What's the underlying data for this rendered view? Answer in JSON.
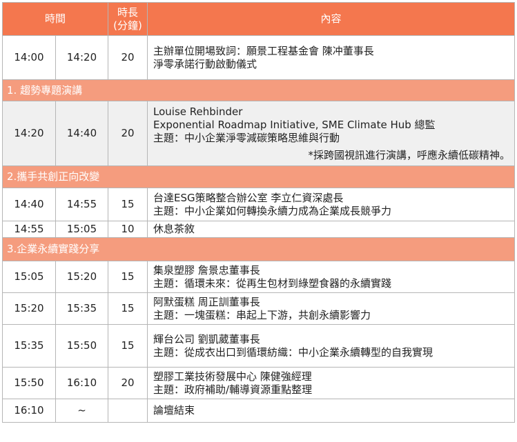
{
  "header": {
    "time": "時間",
    "duration_line1": "時長",
    "duration_line2": "(分鐘)",
    "content": "內容"
  },
  "rows": [
    {
      "start": "14:00",
      "end": "14:20",
      "duration": "20",
      "lines": [
        "主辦單位開場致詞：願景工程基金會 陳冲董事長",
        "淨零承諾行動啟動儀式"
      ]
    },
    {
      "section": "1. 趨勢專題演講"
    },
    {
      "start": "14:20",
      "end": "14:40",
      "duration": "20",
      "lines": [
        "Louise Rehbinder",
        "Exponential Roadmap Initiative, SME Climate Hub 總監",
        "主題：中小企業淨零減碳策略思維與行動"
      ],
      "note": "*採跨國視訊進行演講，呼應永續低碳精神。"
    },
    {
      "section": "2.攜手共創正向改變"
    },
    {
      "start": "14:40",
      "end": "14:55",
      "duration": "15",
      "lines": [
        "台達ESG策略整合辦公室  李立仁資深處長",
        "主題：中小企業如何轉換永續力成為企業成長競爭力"
      ]
    },
    {
      "start": "14:55",
      "end": "15:05",
      "duration": "10",
      "lines": [
        "休息茶敘"
      ]
    },
    {
      "section": "3.企業永續實踐分享"
    },
    {
      "start": "15:05",
      "end": "15:20",
      "duration": "15",
      "lines": [
        "集泉塑膠  詹景忠董事長",
        "主題：循環未來：從再生包材到綠塑食器的永續實踐"
      ]
    },
    {
      "start": "15:20",
      "end": "15:35",
      "duration": "15",
      "lines": [
        "阿默蛋糕  周正訓董事長",
        "主題：一塊蛋糕：串起上下游，共創永續影響力"
      ]
    },
    {
      "start": "15:35",
      "end": "15:50",
      "duration": "15",
      "lines": [
        "輝台公司 劉凱葳董事長",
        "主題：從成衣出口到循環紡織：中小企業永續轉型的自我實現"
      ]
    },
    {
      "start": "15:50",
      "end": "16:10",
      "duration": "20",
      "lines": [
        "塑膠工業技術發展中心  陳健強經理",
        "主題：政府補助/輔導資源重點整理"
      ]
    },
    {
      "start": "16:10",
      "end": "~",
      "duration": "",
      "lines": [
        "論壇結束"
      ]
    }
  ]
}
